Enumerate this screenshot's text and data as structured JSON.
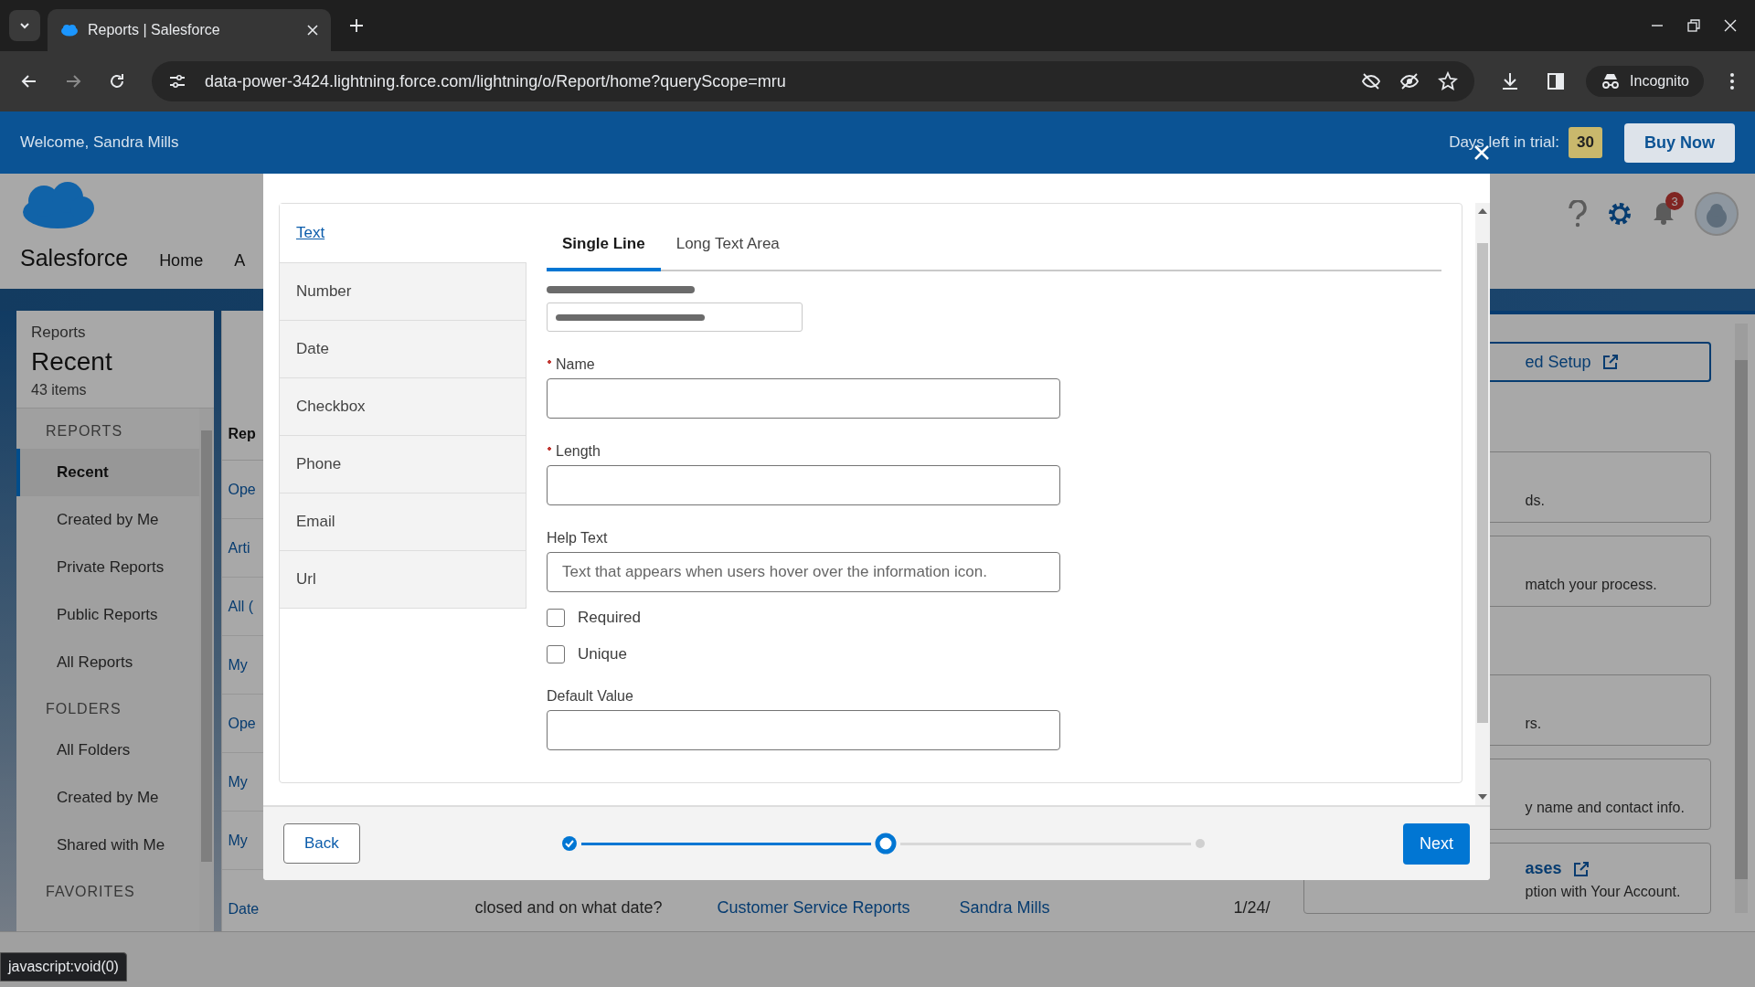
{
  "browser": {
    "tab_title": "Reports | Salesforce",
    "url": "data-power-3424.lightning.force.com/lightning/o/Report/home?queryScope=mru",
    "incognito_label": "Incognito"
  },
  "trial_bar": {
    "welcome": "Welcome, Sandra Mills",
    "days_label": "Days left in trial:",
    "days": "30",
    "buy_button": "Buy Now"
  },
  "app": {
    "name": "Salesforce",
    "nav": [
      "Home",
      "A"
    ],
    "notifications": "3"
  },
  "reports_header": {
    "breadcrumb": "Reports",
    "title": "Recent",
    "count": "43 items"
  },
  "sidebar": [
    {
      "heading": "REPORTS",
      "items": [
        {
          "label": "Recent",
          "selected": true
        },
        {
          "label": "Created by Me",
          "selected": false
        },
        {
          "label": "Private Reports",
          "selected": false
        },
        {
          "label": "Public Reports",
          "selected": false
        },
        {
          "label": "All Reports",
          "selected": false
        }
      ]
    },
    {
      "heading": "FOLDERS",
      "items": [
        {
          "label": "All Folders",
          "selected": false
        },
        {
          "label": "Created by Me",
          "selected": false
        },
        {
          "label": "Shared with Me",
          "selected": false
        }
      ]
    },
    {
      "heading": "FAVORITES"
    }
  ],
  "report_list": {
    "column_1": "Rep",
    "rows": [
      "Ope",
      "Arti",
      "All (",
      "My",
      "Ope",
      "My",
      "My"
    ],
    "last_row": {
      "name": "Date",
      "description": "closed and on what date?",
      "folder": "Customer Service Reports",
      "owner": "Sandra Mills",
      "date": "1/24/"
    }
  },
  "right_panel": {
    "setup_link": "ed Setup",
    "cards": [
      {
        "kind": "text",
        "text": "ds."
      },
      {
        "kind": "text",
        "text": "match your process."
      },
      {
        "kind": "text",
        "text": "rs."
      },
      {
        "kind": "text",
        "text": "y name and contact info."
      },
      {
        "kind": "link",
        "title": "ases",
        "text": "ption with Your Account."
      }
    ]
  },
  "modal": {
    "field_types": [
      {
        "label": "Text",
        "selected": true
      },
      {
        "label": "Number",
        "selected": false
      },
      {
        "label": "Date",
        "selected": false
      },
      {
        "label": "Checkbox",
        "selected": false
      },
      {
        "label": "Phone",
        "selected": false
      },
      {
        "label": "Email",
        "selected": false
      },
      {
        "label": "Url",
        "selected": false
      }
    ],
    "tabs": [
      {
        "label": "Single Line",
        "selected": true
      },
      {
        "label": "Long Text Area",
        "selected": false
      }
    ],
    "fields": [
      {
        "label": "Name",
        "required": true
      },
      {
        "label": "Length",
        "required": true
      },
      {
        "label": "Help Text",
        "required": false,
        "placeholder": "Text that appears when users hover over the information icon."
      }
    ],
    "checkboxes": [
      {
        "label": "Required",
        "checked": false
      },
      {
        "label": "Unique",
        "checked": false
      }
    ],
    "default_value": {
      "label": "Default Value"
    },
    "back_button": "Back",
    "next_button": "Next",
    "steps": [
      {
        "completed": true,
        "selected": false
      },
      {
        "completed": false,
        "selected": true
      },
      {
        "completed": false,
        "selected": false
      }
    ]
  },
  "status_tooltip": "javascript:void(0)"
}
